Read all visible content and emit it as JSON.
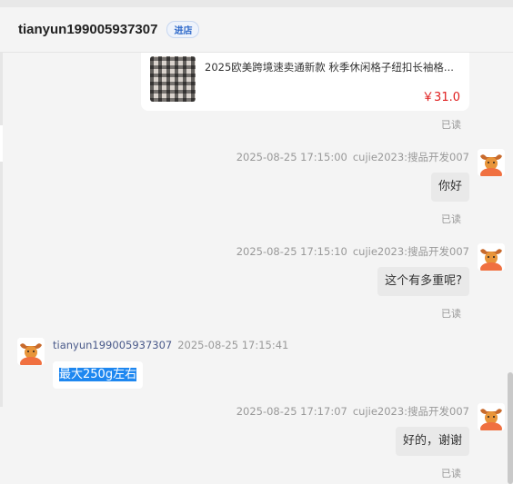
{
  "header": {
    "title": "tianyun199005937307",
    "shop_badge": "进店"
  },
  "product": {
    "title": "2025欧美跨境速卖通新款 秋季休闲格子纽扣长袖格...",
    "price": "￥31.0",
    "read_status": "已读"
  },
  "messages": [
    {
      "side": "right",
      "time": "2025-08-25 17:15:00",
      "sender": "cujie2023:搜品开发007",
      "text": "你好",
      "read_status": "已读"
    },
    {
      "side": "right",
      "time": "2025-08-25 17:15:10",
      "sender": "cujie2023:搜品开发007",
      "text": "这个有多重呢?",
      "read_status": "已读"
    },
    {
      "side": "left",
      "time": "2025-08-25 17:15:41",
      "sender": "tianyun199005937307",
      "text": "最大250g左右"
    },
    {
      "side": "right",
      "time": "2025-08-25 17:17:07",
      "sender": "cujie2023:搜品开发007",
      "text": "好的，谢谢",
      "read_status": "已读"
    }
  ],
  "icons": {
    "avatar": "cow-avatar-icon",
    "product_image": "plaid-shirt-image"
  },
  "colors": {
    "price": "#e02020",
    "selection": "#1e87f0",
    "sender_left": "#4a5a8a",
    "badge": "#2b67c9"
  }
}
